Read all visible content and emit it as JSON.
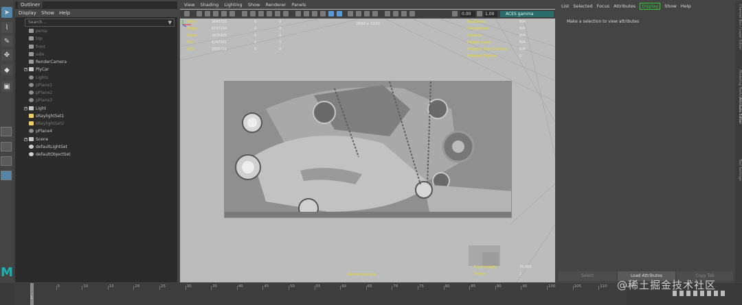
{
  "outliner": {
    "tab_label": "Outliner",
    "menu": [
      "Display",
      "Show",
      "Help"
    ],
    "search_placeholder": "Search...",
    "items": [
      {
        "label": "persp",
        "icon": "camera-icon",
        "dim": true
      },
      {
        "label": "top",
        "icon": "camera-icon",
        "dim": true
      },
      {
        "label": "front",
        "icon": "camera-icon",
        "dim": true
      },
      {
        "label": "side",
        "icon": "camera-icon",
        "dim": true
      },
      {
        "label": "RenderCamera",
        "icon": "camera-icon",
        "dim": false
      },
      {
        "label": "PlyCar",
        "icon": "group-icon",
        "dim": false
      },
      {
        "label": "Lights",
        "icon": "mesh-icon",
        "dim": true
      },
      {
        "label": "pPlane1",
        "icon": "mesh-icon",
        "dim": true
      },
      {
        "label": "pPlane2",
        "icon": "mesh-icon",
        "dim": true
      },
      {
        "label": "pPlane3",
        "icon": "mesh-icon",
        "dim": true
      },
      {
        "label": "Light",
        "icon": "group-icon",
        "dim": false
      },
      {
        "label": "sRaylightSet1",
        "icon": "light-icon",
        "dim": false
      },
      {
        "label": "sRaylightSet2",
        "icon": "light-icon",
        "dim": true
      },
      {
        "label": "pPlane4",
        "icon": "mesh-icon",
        "dim": false
      },
      {
        "label": "Scene",
        "icon": "group-icon",
        "dim": false
      },
      {
        "label": "defaultLightSet",
        "icon": "set-icon",
        "dim": false
      },
      {
        "label": "defaultObjectSet",
        "icon": "set-icon",
        "dim": false
      }
    ]
  },
  "viewport": {
    "menu": [
      "View",
      "Shading",
      "Lighting",
      "Show",
      "Renderer",
      "Panels"
    ],
    "value_a": "0.00",
    "value_b": "1.00",
    "color_mode": "ACES gamma",
    "resolution": "2560 x 1220",
    "hud_left": [
      {
        "label": "Verts:",
        "v1": "3645755",
        "v2": "0",
        "v3": "0"
      },
      {
        "label": "Edges:",
        "v1": "6737194",
        "v2": "0",
        "v3": "0"
      },
      {
        "label": "Faces:",
        "v1": "2626205",
        "v2": "0",
        "v3": "0"
      },
      {
        "label": "Tris:",
        "v1": "6247591",
        "v2": "0",
        "v3": "0"
      },
      {
        "label": "UVs:",
        "v1": "3555721",
        "v2": "0",
        "v3": "0"
      }
    ],
    "hud_right": [
      {
        "label": "Backfaces:",
        "value": "N/A"
      },
      {
        "label": "Smoothness:",
        "value": "N/A"
      },
      {
        "label": "Instance:",
        "value": "N/A"
      },
      {
        "label": "Display Layer:",
        "value": "N/A"
      },
      {
        "label": "Distance From Camera:",
        "value": "N/A"
      },
      {
        "label": "Selected Objects:",
        "value": "0"
      }
    ],
    "hud_bottom_right": [
      {
        "label": "Focal Length:",
        "value": "35.000"
      },
      {
        "label": "Frame:",
        "value": "1"
      }
    ],
    "camera_name": "RenderCamera"
  },
  "attribute_editor": {
    "menu": [
      "List",
      "Selected",
      "Focus",
      "Attributes",
      "Display",
      "Show",
      "Help"
    ],
    "highlighted_menu": "Display",
    "message": "Make a selection to view attributes",
    "buttons": [
      "Select",
      "Load Attributes",
      "Copy Tab"
    ],
    "active_button": "Load Attributes",
    "side_tabs": [
      "Channel Box / Layer Editor",
      "Modeling Toolkit",
      "Attribute Editor",
      "Tool Settings"
    ],
    "active_side_tab": "Attribute Editor"
  },
  "timeline": {
    "ticks": [
      "5",
      "10",
      "15",
      "20",
      "25",
      "30",
      "35",
      "40",
      "45",
      "50",
      "55",
      "60",
      "65",
      "70",
      "75",
      "80",
      "85",
      "90",
      "95",
      "100",
      "105",
      "110",
      "115"
    ],
    "current_frame": "1"
  },
  "watermark": "@稀土掘金技术社区",
  "colors": {
    "hud_yellow": "#e8e020",
    "accent_blue": "#5285a6",
    "display_green": "#33cc33",
    "maya_teal": "#19b3b3"
  }
}
